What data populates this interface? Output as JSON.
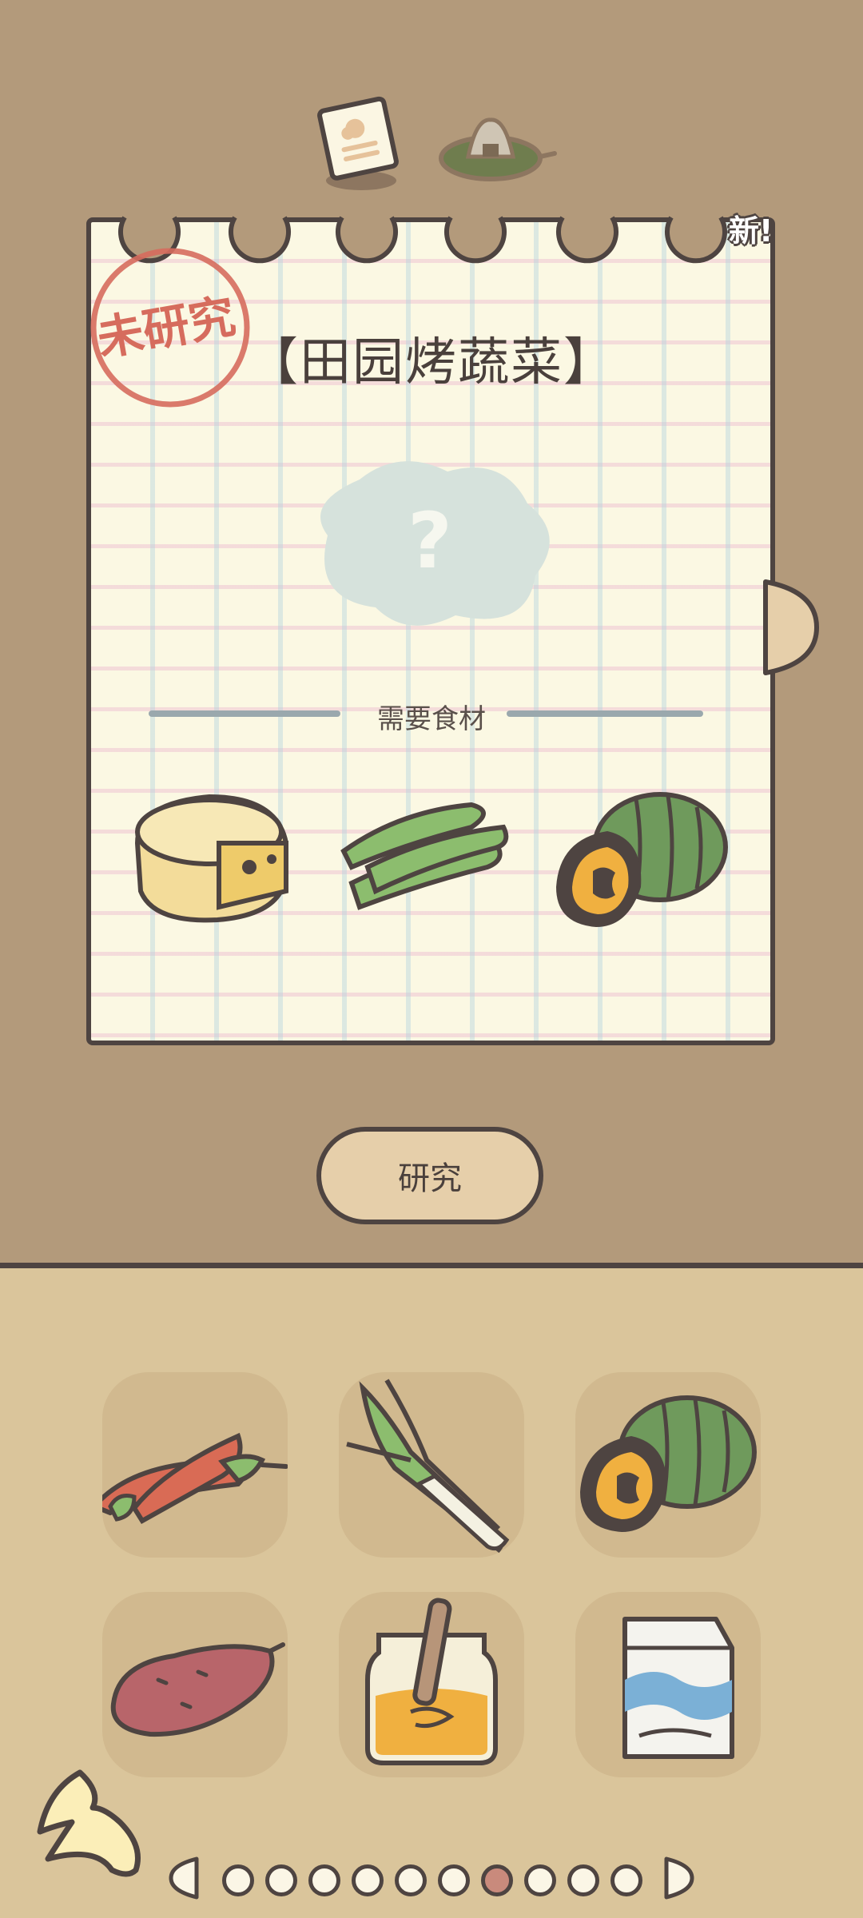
{
  "recipe": {
    "title": "【田园烤蔬菜】",
    "status_stamp": "未研究",
    "new_badge": "新!",
    "unknown_mark": "?",
    "section_label": "需要食材",
    "required_ingredients": [
      "cheese-icon",
      "edamame-icon",
      "pumpkin-icon"
    ]
  },
  "research_button": {
    "label": "研究"
  },
  "tabs": [
    "recipe-note-icon",
    "onigiri-icon"
  ],
  "inventory": [
    "chili-pepper-icon",
    "green-onion-icon",
    "pumpkin-icon",
    "sweet-potato-icon",
    "honey-jar-icon",
    "milk-carton-icon"
  ],
  "pagination": {
    "total": 10,
    "current": 7
  },
  "colors": {
    "background": "#b39a7b",
    "paper": "#fbf8e3",
    "outline": "#4e4441",
    "panel": "#dac59b",
    "slot": "#d1b98f",
    "button": "#e6cfaa",
    "stamp": "#d66c5d",
    "active_dot": "#c98a7c"
  }
}
